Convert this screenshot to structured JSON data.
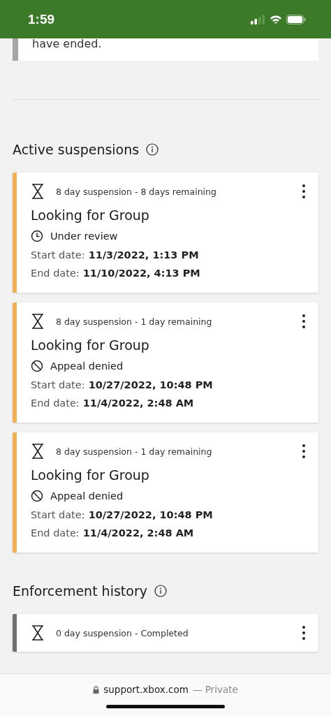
{
  "status_bar": {
    "time": "1:59"
  },
  "previous_card": {
    "text": "have ended.",
    "color": "#a6a6a6"
  },
  "sections": [
    {
      "title": "Active suspensions",
      "cards": [
        {
          "color": "#f0b155",
          "summary": "8 day suspension - 8 days remaining",
          "title": "Looking for Group",
          "kind": "review",
          "status": "Under review",
          "start_label": "Start date:",
          "start": "11/3/2022, 1:13 PM",
          "end_label": "End date:",
          "end": "11/10/2022, 4:13 PM"
        },
        {
          "color": "#f0b155",
          "summary": "8 day suspension - 1 day remaining",
          "title": "Looking for Group",
          "kind": "denied",
          "status": "Appeal denied",
          "start_label": "Start date:",
          "start": "10/27/2022, 10:48 PM",
          "end_label": "End date:",
          "end": "11/4/2022, 2:48 AM"
        },
        {
          "color": "#f0b155",
          "summary": "8 day suspension - 1 day remaining",
          "title": "Looking for Group",
          "kind": "denied",
          "status": "Appeal denied",
          "start_label": "Start date:",
          "start": "10/27/2022, 10:48 PM",
          "end_label": "End date:",
          "end": "11/4/2022, 2:48 AM"
        }
      ]
    },
    {
      "title": "Enforcement history",
      "cards": [
        {
          "color": "#707070",
          "kind": "summary",
          "summary": "0 day suspension - Completed"
        }
      ]
    }
  ],
  "browser_bar": {
    "domain": "support.xbox.com",
    "mode": "— Private"
  }
}
